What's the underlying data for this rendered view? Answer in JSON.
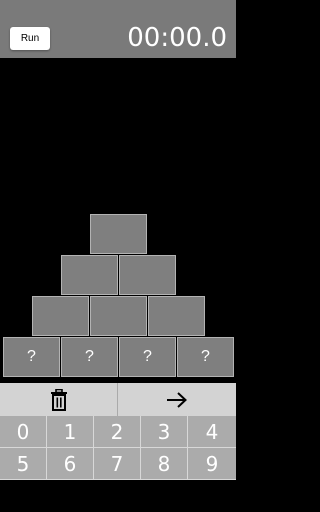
{
  "header": {
    "run_label": "Run",
    "timer": "00:00.0"
  },
  "pyramid": {
    "rows": [
      [
        "",
        "",
        "",
        ""
      ],
      [
        "",
        "",
        ""
      ],
      [
        "",
        ""
      ],
      [
        ""
      ]
    ],
    "bottom_row_values": [
      "?",
      "?",
      "?",
      "?"
    ]
  },
  "controls": {
    "delete_icon": "trash-icon",
    "next_icon": "arrow-right-icon"
  },
  "keypad": {
    "keys": [
      "0",
      "1",
      "2",
      "3",
      "4",
      "5",
      "6",
      "7",
      "8",
      "9"
    ]
  },
  "colors": {
    "topbar": "#7a7a7a",
    "block": "#7f7f7f",
    "control_bg": "#d3d3d3",
    "keypad_bg": "#ababab"
  }
}
